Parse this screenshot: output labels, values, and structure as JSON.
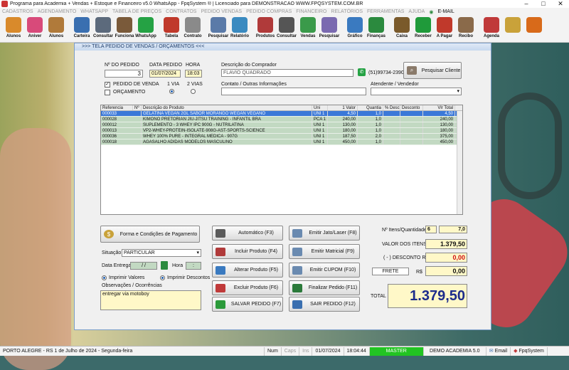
{
  "app": {
    "title": "Programa para Academia + Vendas + Estoque e Financeiro v5.0 WhatsApp - FpqSystem ® | Licenciado para  DEMONSTRACAO WWW.FPQSYSTEM.COM.BR"
  },
  "menu": [
    "CADASTROS",
    "AGENDAMENTO",
    "WHATSAPP",
    "TABELA DE PREÇOS",
    "CONTRATOS",
    "PEDIDO VENDAS",
    "PEDIDO COMPRAS",
    "FINANCEIRO",
    "RELATÓRIOS",
    "FERRAMENTAS",
    "AJUDA",
    "E-MAIL"
  ],
  "toolbar": [
    {
      "label": "Alunos",
      "icon": "students-icon",
      "color": "#d98a2b"
    },
    {
      "label": "Aniver",
      "icon": "cake-icon",
      "color": "#d84a7a"
    },
    {
      "label": "Alunos",
      "icon": "student-icon",
      "color": "#b07a3a"
    },
    {
      "label": "Carteira",
      "icon": "id-card-icon",
      "color": "#3a6fb0"
    },
    {
      "label": "Consultar",
      "icon": "search-card-icon",
      "color": "#5c6a7c"
    },
    {
      "label": "Funciona",
      "icon": "employee-icon",
      "color": "#7a5a3a"
    },
    {
      "label": "WhatsApp",
      "icon": "whatsapp-icon",
      "color": "#25a244"
    },
    {
      "label": "Tabela",
      "icon": "price-table-icon",
      "color": "#c0392b"
    },
    {
      "label": "Contrato",
      "icon": "contract-icon",
      "color": "#8a8a8a"
    },
    {
      "label": "Pesquisar",
      "icon": "search-icon",
      "color": "#5a7aa8"
    },
    {
      "label": "Relatório",
      "icon": "report-icon",
      "color": "#3a8ac0"
    },
    {
      "label": "Produtos",
      "icon": "products-icon",
      "color": "#b03a3a"
    },
    {
      "label": "Consultar",
      "icon": "consult-icon",
      "color": "#555555"
    },
    {
      "label": "Vendas",
      "icon": "cart-icon",
      "color": "#3a9a4a"
    },
    {
      "label": "Pesquisar",
      "icon": "search-sales-icon",
      "color": "#7a6ab0"
    },
    {
      "label": "Gráfico",
      "icon": "chart-icon",
      "color": "#3a7ac0"
    },
    {
      "label": "Finanças",
      "icon": "finance-icon",
      "color": "#2b8a3e"
    },
    {
      "label": "Caixa",
      "icon": "cash-icon",
      "color": "#7a5a2b"
    },
    {
      "label": "Receber",
      "icon": "receive-icon",
      "color": "#1f9a3a"
    },
    {
      "label": "A Pagar",
      "icon": "pay-icon",
      "color": "#c0392b"
    },
    {
      "label": "Recibo",
      "icon": "receipt-icon",
      "color": "#8a6a4a"
    },
    {
      "label": "Agenda",
      "icon": "calendar-icon",
      "color": "#c03a3a"
    },
    {
      "label": "",
      "icon": "coins-icon",
      "color": "#c9a23a"
    },
    {
      "label": "",
      "icon": "exit-icon",
      "color": "#d86a1a"
    }
  ],
  "window": {
    "title": ">>>  TELA PEDIDO DE VENDAS / ORÇAMENTOS  <<<"
  },
  "order": {
    "num_label": "Nº DO PEDIDO",
    "num": "3",
    "date_label": "DATA PEDIDO",
    "date": "01/07/2024",
    "time_label": "HORA",
    "time": "18:03",
    "chk_pedido": "PEDIDO DE VENDA",
    "chk_orcamento": "ORÇAMENTO",
    "via1": "1 VIA",
    "via2": "2 VIAS",
    "buyer_label": "Descrição do Comprador",
    "buyer": "FLAVIO QUADRADO",
    "phone": "(51)99734-2390",
    "search_client": "Pesquisar Cliente",
    "contacts_label": "Contato / Outras Informações",
    "contacts": "",
    "seller_label": "Atendente / Vendedor",
    "seller": ""
  },
  "table": {
    "headers": [
      "Referencia",
      "Nº",
      "Descrição do Produto",
      "Uni",
      "1 Valor",
      "Quantia",
      "% Desc.",
      "Desconto",
      "Vlr Total"
    ],
    "rows": [
      [
        "000033",
        "GELATINA VEGAN 2GL SABOR MORANGO WEGAN VEGANO",
        "UNI 1",
        "4,50",
        "1,0",
        "",
        "",
        "4,50"
      ],
      [
        "000028",
        "KIMONO PRETORIAN JIU-JITSU TRAINING - INFANTIL BRA",
        "PCA 1",
        "240,00",
        "1,0",
        "",
        "",
        "240,00"
      ],
      [
        "000012",
        "SUPLEMENTO - 3 WHEY IPC 900G - NUTRILATINA",
        "UNI 1",
        "130,00",
        "1,0",
        "",
        "",
        "130,00"
      ],
      [
        "000013",
        "VP2-WHEY-PROTEIN-ISOLATE-908G-AST-SPORTS-SCIENCE",
        "UNI 1",
        "180,00",
        "1,0",
        "",
        "",
        "180,00"
      ],
      [
        "000036",
        "WHEY 100% PURE - INTEGRAL MÉDICA - 907G",
        "UNI 1",
        "187,50",
        "2,0",
        "",
        "",
        "375,00"
      ],
      [
        "000018",
        "AGASALHO ADIDAS MODELOS MASCULINO",
        "UNI 1",
        "450,00",
        "1,0",
        "",
        "",
        "450,00"
      ]
    ]
  },
  "payment": {
    "btn": "Forma e Condições de Pagamento",
    "situacao_label": "Situação",
    "situacao": "PARTICULAR",
    "entrega_label": "Data Entrega",
    "entrega": " / / ",
    "hora_label": "Hora",
    "hora": " : ",
    "imp_valores": "Imprimir Valores",
    "imp_descontos": "Imprimir Descontos",
    "obs_label": "Observações / Ocorrências",
    "obs": "entregar via motoboy"
  },
  "actions": [
    {
      "label": "Automático    (F3)",
      "icon": "auto-icon",
      "color": "#5a5a5a"
    },
    {
      "label": "Incluir Produto  (F4)",
      "icon": "add-product-icon",
      "color": "#b03a3a"
    },
    {
      "label": "Alterar Produto  (F5)",
      "icon": "edit-product-icon",
      "color": "#3a7ac0"
    },
    {
      "label": "Excluir Produto  (F6)",
      "icon": "delete-product-icon",
      "color": "#c03a3a"
    },
    {
      "label": "SALVAR PEDIDO (F7)",
      "icon": "save-icon",
      "color": "#2b9a3a"
    },
    {
      "label": "Emitir Jato/Laser (F8)",
      "icon": "print-icon",
      "color": "#6a8ab0"
    },
    {
      "label": "Emitir Matricial  (F9)",
      "icon": "dot-printer-icon",
      "color": "#6a8ab0"
    },
    {
      "label": "Emitir CUPOM   (F10)",
      "icon": "coupon-icon",
      "color": "#6a8ab0"
    },
    {
      "label": "Finalizar Pedido  (F11)",
      "icon": "finish-icon",
      "color": "#2b7a3a"
    },
    {
      "label": "SAIR  PEDIDO  (F12)",
      "icon": "exit-order-icon",
      "color": "#3a6fb0"
    }
  ],
  "totals": {
    "itens_label": "Nº Itens/Quantidade",
    "itens": "6",
    "quantidade": "7,0",
    "valor_label": "VALOR DOS ITENS R$",
    "valor": "1.379,50",
    "desconto_label": "( - ) DESCONTO R$",
    "desconto": "0,00",
    "frete_label": "FRETE",
    "frete_rs": "R$",
    "frete": "0,00",
    "total_label": "TOTAL",
    "total": "1.379,50"
  },
  "status": {
    "city": "PORTO ALEGRE - RS  1 de Julho de 2024 - Segunda-feira",
    "num": "Num",
    "caps": "Caps",
    "ins": "Ins",
    "date": "01/07/2024",
    "time": "18:04:44",
    "master": "MASTER",
    "demo": "DEMO ACADEMIA 5.0",
    "email": "Email",
    "brand": "FpqSystem"
  }
}
